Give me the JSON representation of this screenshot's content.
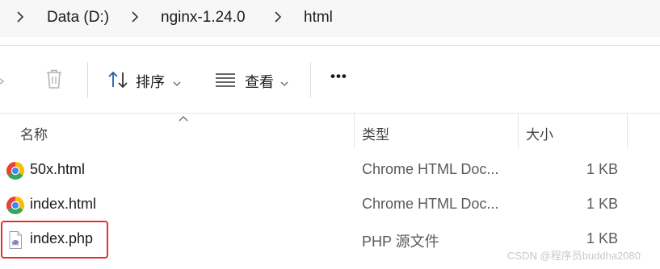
{
  "breadcrumb": {
    "items": [
      "Data (D:)",
      "nginx-1.24.0",
      "html"
    ]
  },
  "toolbar": {
    "sort_label": "排序",
    "view_label": "查看",
    "more_label": "•••"
  },
  "columns": {
    "name": "名称",
    "type": "类型",
    "size": "大小"
  },
  "files": [
    {
      "name": "50x.html",
      "type": "Chrome HTML Doc...",
      "size": "1 KB",
      "icon": "chrome-icon"
    },
    {
      "name": "index.html",
      "type": "Chrome HTML Doc...",
      "size": "1 KB",
      "icon": "chrome-icon"
    },
    {
      "name": "index.php",
      "type": "PHP 源文件",
      "size": "1 KB",
      "icon": "php-file-icon"
    }
  ],
  "watermark": "CSDN @程序员buddha2080",
  "colors": {
    "highlight": "#e0322c",
    "breadcrumb_bg": "#f7f7f7"
  }
}
